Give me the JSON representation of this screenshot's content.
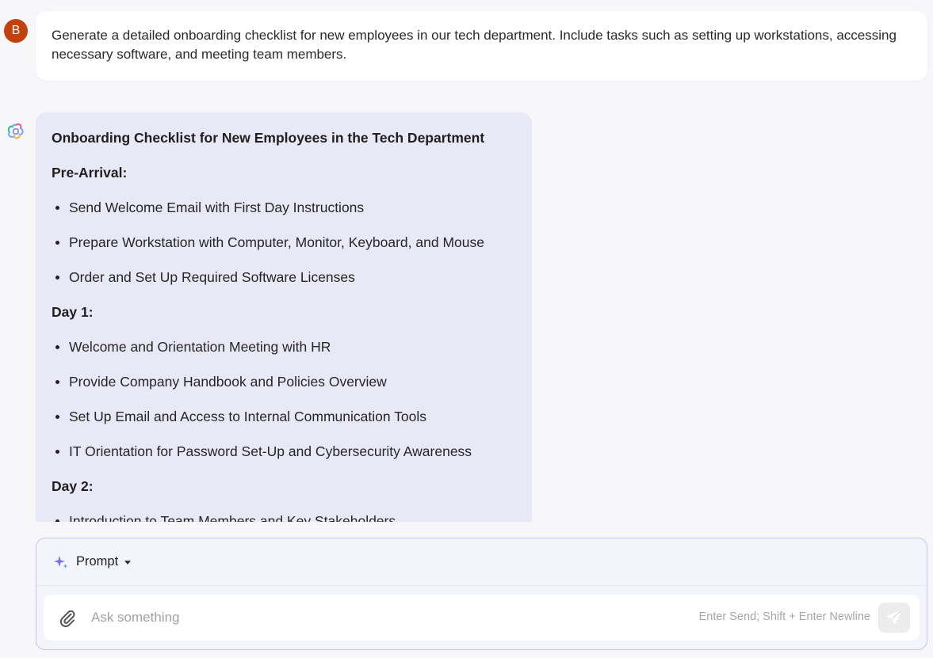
{
  "user_message": {
    "avatar_initial": "B",
    "avatar_color": "#c2410c",
    "text": "Generate a detailed onboarding checklist for new employees in our tech department. Include tasks such as setting up workstations, accessing necessary software, and meeting team members."
  },
  "assistant_message": {
    "icon": "ai-assistant-logo-icon",
    "bubble_color": "#e8e8f6",
    "title": "Onboarding Checklist for New Employees in the Tech Department",
    "sections": [
      {
        "heading": "Pre-Arrival:",
        "items": [
          "Send Welcome Email with First Day Instructions",
          "Prepare Workstation with Computer, Monitor, Keyboard, and Mouse",
          "Order and Set Up Required Software Licenses"
        ]
      },
      {
        "heading": "Day 1:",
        "items": [
          "Welcome and Orientation Meeting with HR",
          "Provide Company Handbook and Policies Overview",
          "Set Up Email and Access to Internal Communication Tools",
          "IT Orientation for Password Set-Up and Cybersecurity Awareness"
        ]
      },
      {
        "heading": "Day 2:",
        "items": [
          "Introduction to Team Members and Key Stakeholders"
        ]
      }
    ]
  },
  "composer": {
    "mode_icon": "sparkle-icon",
    "mode_label": "Prompt",
    "attach_icon": "paperclip-icon",
    "input_placeholder": "Ask something",
    "input_value": "",
    "hint": "Enter Send; Shift + Enter Newline",
    "send_icon": "send-icon",
    "border_color": "#c9c3ef"
  }
}
